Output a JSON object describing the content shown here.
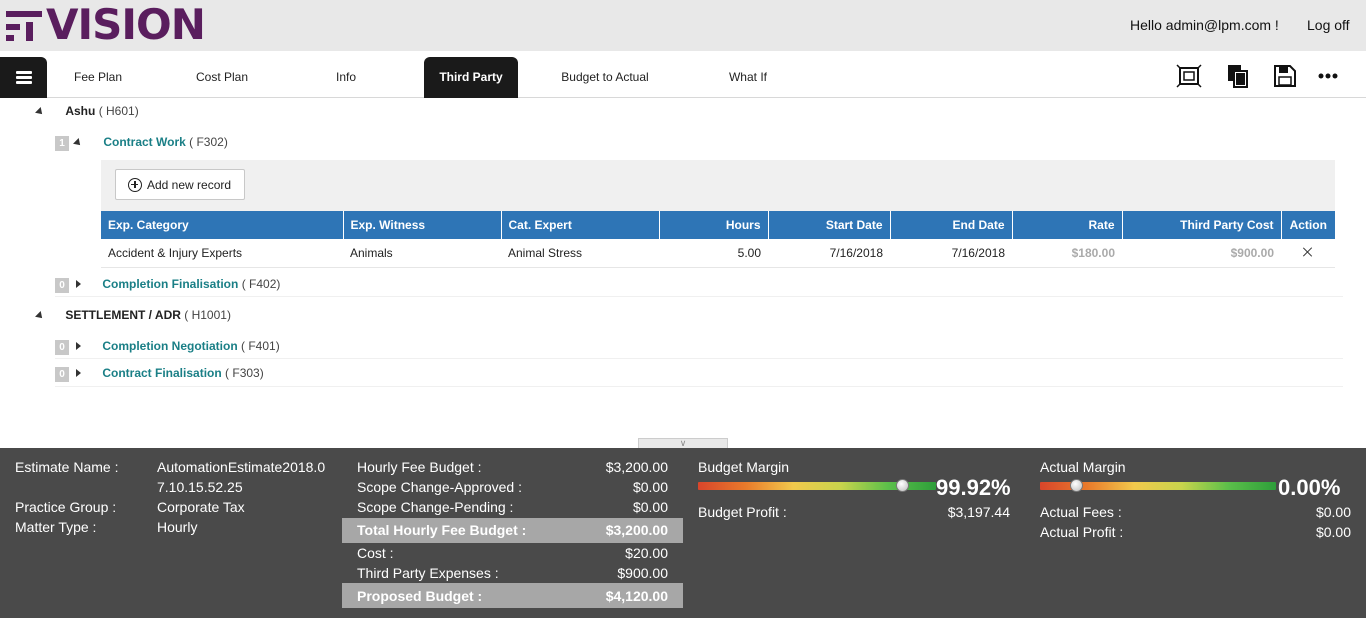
{
  "header": {
    "logo": "VISION",
    "greeting": "Hello admin@lpm.com !",
    "logoff": "Log off"
  },
  "nav": {
    "tabs": [
      {
        "label": "Fee Plan"
      },
      {
        "label": "Cost Plan"
      },
      {
        "label": "Info"
      },
      {
        "label": "Third Party",
        "active": true
      },
      {
        "label": "Budget to Actual"
      },
      {
        "label": "What If"
      }
    ],
    "tools": [
      "fit-screen-icon",
      "copy-icon",
      "save-icon",
      "more-icon"
    ]
  },
  "tree": {
    "groups": [
      {
        "name": "Ashu",
        "code": "( H601)",
        "items": [
          {
            "count": "1",
            "name": "Contract Work",
            "code": "( F302)",
            "expanded": true
          },
          {
            "count": "0",
            "name": "Completion Finalisation",
            "code": "( F402)",
            "expanded": false
          }
        ]
      },
      {
        "name": "SETTLEMENT / ADR",
        "code": "( H1001)",
        "items": [
          {
            "count": "0",
            "name": "Completion Negotiation",
            "code": "( F401)",
            "expanded": false
          },
          {
            "count": "0",
            "name": "Contract Finalisation",
            "code": "( F303)",
            "expanded": false
          }
        ]
      }
    ]
  },
  "third_party": {
    "add_label": "Add new record",
    "columns": [
      "Exp. Category",
      "Exp. Witness",
      "Cat. Expert",
      "Hours",
      "Start Date",
      "End Date",
      "Rate",
      "Third Party Cost",
      "Action"
    ],
    "rows": [
      [
        "Accident & Injury Experts",
        "Animals",
        "Animal Stress",
        "5.00",
        "7/16/2018",
        "7/16/2018",
        "$180.00",
        "$900.00"
      ]
    ]
  },
  "footer": {
    "estimate_name_label": "Estimate Name :",
    "estimate_name_line1": "AutomationEstimate2018.0",
    "estimate_name_line2": "7.10.15.52.25",
    "practice_group_label": "Practice Group :",
    "practice_group": "Corporate Tax",
    "matter_type_label": "Matter Type :",
    "matter_type": "Hourly",
    "budget_lines": [
      {
        "label": "Hourly Fee Budget :",
        "value": "$3,200.00"
      },
      {
        "label": "Scope Change-Approved :",
        "value": "$0.00"
      },
      {
        "label": "Scope Change-Pending :",
        "value": "$0.00"
      }
    ],
    "total_hourly": {
      "label": "Total Hourly Fee Budget :",
      "value": "$3,200.00"
    },
    "cost_lines": [
      {
        "label": "Cost :",
        "value": "$20.00"
      },
      {
        "label": "Third Party Expenses :",
        "value": "$900.00"
      }
    ],
    "proposed": {
      "label": "Proposed Budget :",
      "value": "$4,120.00"
    },
    "budget_margin": {
      "label": "Budget Margin",
      "value": "99.92%",
      "level": 0.9992,
      "profit_label": "Budget Profit :",
      "profit": "$3,197.44"
    },
    "actual_margin": {
      "label": "Actual Margin",
      "value": "0.00%",
      "level": 0.0,
      "fees_label": "Actual Fees :",
      "fees": "$0.00",
      "profit_label": "Actual Profit :",
      "profit": "$0.00"
    }
  }
}
